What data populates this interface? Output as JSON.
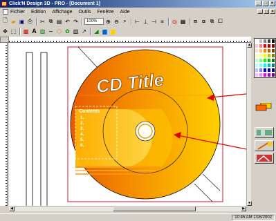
{
  "window": {
    "title": "Click'N Design 3D - PRO - [Document 1]"
  },
  "menu": {
    "items": [
      "Fichier",
      "Edition",
      "Affichage",
      "Outils",
      "Fenêtre",
      "Aide"
    ]
  },
  "toolbar": {
    "zoom_value": "100%"
  },
  "canvas": {
    "cd_title": "CD Title",
    "contents_heading": "Contents",
    "contents_lines": [
      "1.",
      "2.",
      "3.",
      "4.",
      "5.",
      "6."
    ]
  },
  "palette": {
    "colors": [
      "#ffffff",
      "#c0c0c0",
      "#808080",
      "#404040",
      "#000000",
      "#ffcccc",
      "#ff8080",
      "#ff0000",
      "#c00000",
      "#800000",
      "#ffe0c0",
      "#ffc080",
      "#ff8000",
      "#c06000",
      "#804000",
      "#ffffc0",
      "#ffff80",
      "#ffff00",
      "#c0c000",
      "#808000",
      "#c0ffc0",
      "#80ff80",
      "#00ff00",
      "#00c000",
      "#008000",
      "#c0ffff",
      "#80ffff",
      "#00ffff",
      "#00c0c0",
      "#008080",
      "#c0c0ff",
      "#8080ff",
      "#0000ff",
      "#0000c0",
      "#000080",
      "#ffc0ff",
      "#ff80ff",
      "#ff00ff",
      "#c000c0",
      "#800080"
    ],
    "fill_primary": "#ff6600",
    "fill_secondary": "#ffcc00"
  },
  "status": {
    "time": "10:45 AM  1/16/2002"
  },
  "colors": {
    "disc_orange": "#f07800",
    "disc_yellow": "#ffc000",
    "arrow_red": "#e00000"
  }
}
